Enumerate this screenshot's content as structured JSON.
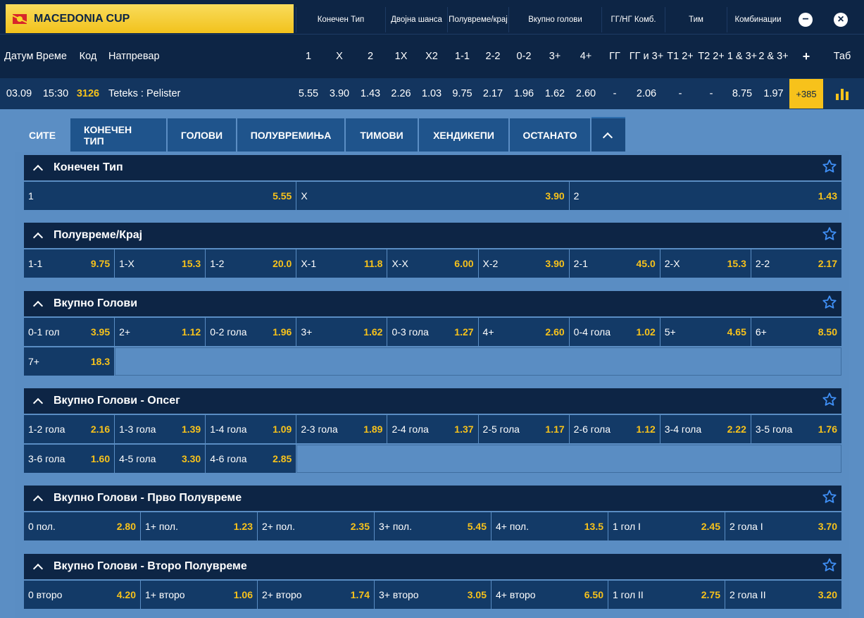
{
  "competition": {
    "name": "MACEDONIA CUP"
  },
  "header_groups": [
    {
      "label": "Конечен Тип"
    },
    {
      "label": "Двојна шанса"
    },
    {
      "label": "Полувреме/крај"
    },
    {
      "label": "Вкупно голови"
    },
    {
      "label": "ГГ/НГ Комб."
    },
    {
      "label": "Тим"
    },
    {
      "label": "Комбинации"
    }
  ],
  "controls": {
    "minus": "−",
    "close": "×",
    "plus": "+",
    "tab": "Таб"
  },
  "columns": [
    "Датум",
    "Време",
    "Код",
    "Натпревар",
    "1",
    "X",
    "2",
    "1X",
    "X2",
    "1-1",
    "2-2",
    "0-2",
    "3+",
    "4+",
    "ГГ",
    "ГГ и 3+",
    "Т1 2+",
    "Т2 2+",
    "1 & 3+",
    "2 & 3+"
  ],
  "match": {
    "date": "03.09",
    "time": "15:30",
    "code": "3126",
    "name": "Teteks : Pelister",
    "odds": [
      "5.55",
      "3.90",
      "1.43",
      "2.26",
      "1.03",
      "9.75",
      "2.17",
      "1.96",
      "1.62",
      "2.60",
      "-",
      "2.06",
      "-",
      "-",
      "8.75",
      "1.97"
    ],
    "more": "+385"
  },
  "tabs": [
    "СИТЕ",
    "КОНЕЧЕН ТИП",
    "ГОЛОВИ",
    "ПОЛУВРЕМИЊА",
    "ТИМОВИ",
    "ХЕНДИКЕПИ",
    "ОСТАНАТО"
  ],
  "markets": [
    {
      "title": "Конечен Тип",
      "rows": [
        [
          [
            "1",
            "5.55"
          ],
          [
            "X",
            "3.90"
          ],
          [
            "2",
            "1.43"
          ]
        ]
      ]
    },
    {
      "title": "Полувреме/Крај",
      "rows": [
        [
          [
            "1-1",
            "9.75"
          ],
          [
            "1-X",
            "15.3"
          ],
          [
            "1-2",
            "20.0"
          ],
          [
            "X-1",
            "11.8"
          ],
          [
            "X-X",
            "6.00"
          ],
          [
            "X-2",
            "3.90"
          ],
          [
            "2-1",
            "45.0"
          ],
          [
            "2-X",
            "15.3"
          ],
          [
            "2-2",
            "2.17"
          ]
        ]
      ]
    },
    {
      "title": "Вкупно Голови",
      "rows": [
        [
          [
            "0-1 гол",
            "3.95"
          ],
          [
            "2+",
            "1.12"
          ],
          [
            "0-2 гола",
            "1.96"
          ],
          [
            "3+",
            "1.62"
          ],
          [
            "0-3 гола",
            "1.27"
          ],
          [
            "4+",
            "2.60"
          ],
          [
            "0-4 гола",
            "1.02"
          ],
          [
            "5+",
            "4.65"
          ],
          [
            "6+",
            "8.50"
          ]
        ],
        [
          [
            "7+",
            "18.3"
          ]
        ]
      ]
    },
    {
      "title": "Вкупно Голови - Опсег",
      "rows": [
        [
          [
            "1-2 гола",
            "2.16"
          ],
          [
            "1-3 гола",
            "1.39"
          ],
          [
            "1-4 гола",
            "1.09"
          ],
          [
            "2-3 гола",
            "1.89"
          ],
          [
            "2-4 гола",
            "1.37"
          ],
          [
            "2-5 гола",
            "1.17"
          ],
          [
            "2-6 гола",
            "1.12"
          ],
          [
            "3-4 гола",
            "2.22"
          ],
          [
            "3-5 гола",
            "1.76"
          ]
        ],
        [
          [
            "3-6 гола",
            "1.60"
          ],
          [
            "4-5 гола",
            "3.30"
          ],
          [
            "4-6 гола",
            "2.85"
          ]
        ]
      ]
    },
    {
      "title": "Вкупно Голови - Прво Полувреме",
      "rows": [
        [
          [
            "0 пол.",
            "2.80"
          ],
          [
            "1+ пол.",
            "1.23"
          ],
          [
            "2+ пол.",
            "2.35"
          ],
          [
            "3+ пол.",
            "5.45"
          ],
          [
            "4+ пол.",
            "13.5"
          ],
          [
            "1 гол I",
            "2.45"
          ],
          [
            "2 гола I",
            "3.70"
          ]
        ]
      ]
    },
    {
      "title": "Вкупно Голови - Второ Полувреме",
      "rows": [
        [
          [
            "0 второ",
            "4.20"
          ],
          [
            "1+ второ",
            "1.06"
          ],
          [
            "2+ второ",
            "1.74"
          ],
          [
            "3+ второ",
            "3.05"
          ],
          [
            "4+ второ",
            "6.50"
          ],
          [
            "1 гол II",
            "2.75"
          ],
          [
            "2 гола II",
            "3.20"
          ]
        ]
      ]
    }
  ]
}
